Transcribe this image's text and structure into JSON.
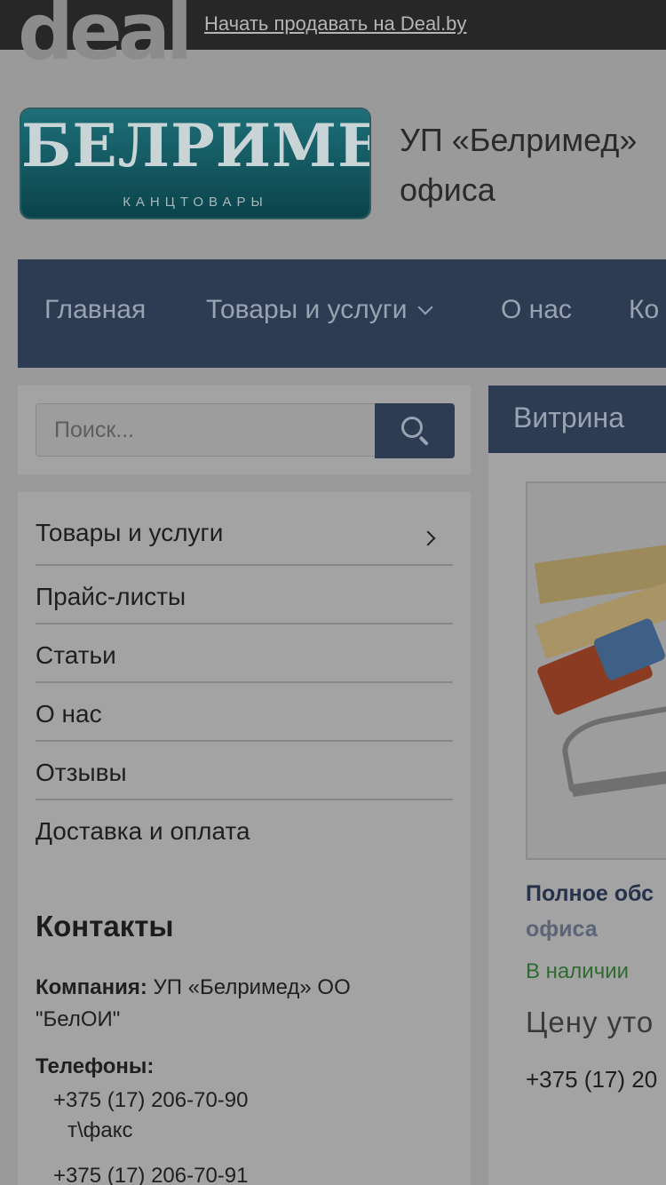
{
  "topbar": {
    "logo_text": "deal",
    "sell_link": "Начать продавать на Deal.by"
  },
  "header": {
    "logo_main": "БЕЛРИМЕД",
    "logo_sub": "КАНЦТОВАРЫ",
    "company_line1": "УП «Белримед»",
    "company_line2": "офиса"
  },
  "nav": {
    "items": [
      {
        "label": "Главная"
      },
      {
        "label": "Товары и услуги"
      },
      {
        "label": "О нас"
      },
      {
        "label": "Ко"
      }
    ]
  },
  "search": {
    "placeholder": "Поиск..."
  },
  "sidebar": {
    "items": [
      {
        "label": "Товары и услуги"
      },
      {
        "label": "Прайс-листы"
      },
      {
        "label": "Статьи"
      },
      {
        "label": "О нас"
      },
      {
        "label": "Отзывы"
      },
      {
        "label": "Доставка и оплата"
      }
    ]
  },
  "contacts": {
    "title": "Контакты",
    "company_label": "Компания:",
    "company_value": " УП «Белримед» ОО",
    "company_value2": "\"БелОИ\"",
    "phones_label": "Телефоны:",
    "phone1": "+375 (17) 206-70-90",
    "phone1_note": "т\\факс",
    "phone2": "+375 (17) 206-70-91"
  },
  "showcase": {
    "tab_label": "Витрина",
    "product_name_line1": "Полное обс",
    "product_name_line2": "офиса",
    "stock": "В наличии",
    "price": "Цену уто",
    "phone": "+375 (17) 20"
  }
}
